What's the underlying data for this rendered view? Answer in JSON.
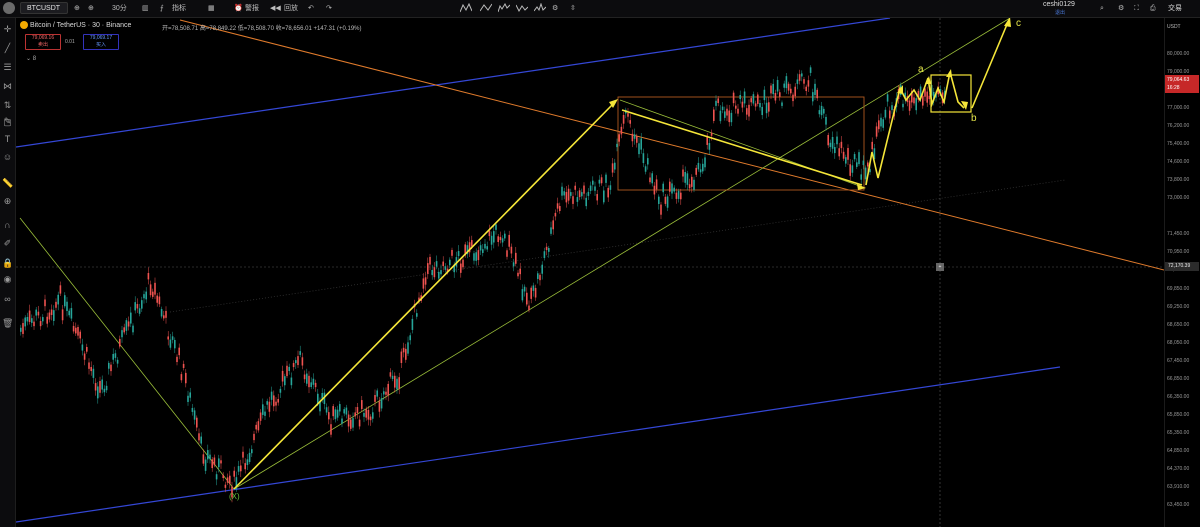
{
  "topbar": {
    "symbol": "BTCUSDT",
    "interval": "30分",
    "indicators_label": "指标",
    "alert_label": "警报",
    "replay_label": "回放",
    "username": "ceshi0129",
    "user_sub": "退出",
    "trade_label": "交易"
  },
  "legend": {
    "title": "Bitcoin / TetherUS · 30 · Binance",
    "ohlc": "开=78,508.71 高=78,849.22 低=78,508.70 收=78,656.01 +147.31 (+0.19%)",
    "sell_price": "79,069.16",
    "sell_label": "卖出",
    "buy_price": "79,069.17",
    "buy_label": "买入",
    "spread": "0.01",
    "volume": "8"
  },
  "axis": {
    "currency": "USDT",
    "ticks": [
      "80,000.00",
      "79,000.00",
      "78,000.00",
      "77,000.00",
      "76,200.00",
      "75,400.00",
      "74,600.00",
      "73,800.00",
      "73,000.00",
      "72,170.39",
      "71,450.00",
      "70,950.00",
      "70,450.00",
      "69,850.00",
      "69,250.00",
      "68,650.00",
      "68,050.00",
      "67,450.00",
      "66,850.00",
      "66,350.00",
      "65,850.00",
      "65,350.00",
      "64,850.00",
      "64,370.00",
      "63,910.00",
      "63,450.00"
    ],
    "last_price": "79,064.63",
    "countdown": "16:28",
    "crosshair_price": "72,170.39"
  },
  "waves": {
    "a": "a",
    "b": "b",
    "c": "c",
    "x": "(X)"
  },
  "colors": {
    "up": "#26a69a",
    "down": "#ef5350",
    "projection": "#f5e639",
    "channel": "#3447d6",
    "trendline": "#e07b2c",
    "support": "#9bbf3a"
  },
  "icons": {
    "left_toolbar": [
      "crosshair-icon",
      "trendline-icon",
      "fib-icon",
      "pattern-icon",
      "projection-icon",
      "brush-icon",
      "rectangle-icon",
      "text-icon",
      "emoji-icon",
      "ruler-icon",
      "zoom-icon",
      "magnet-icon",
      "lock-icon",
      "drawing-mode-icon",
      "eye-icon",
      "link-icon",
      "trash-icon"
    ]
  }
}
